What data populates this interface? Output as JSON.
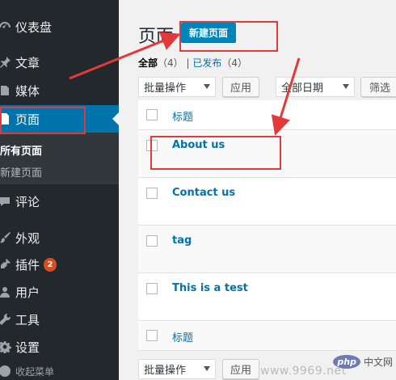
{
  "sidebar": {
    "items": [
      {
        "label": "仪表盘",
        "icon": "dashboard-icon"
      },
      {
        "label": "文章",
        "icon": "pin-icon"
      },
      {
        "label": "媒体",
        "icon": "media-icon"
      },
      {
        "label": "页面",
        "icon": "page-icon"
      },
      {
        "label": "评论",
        "icon": "comment-icon"
      },
      {
        "label": "外观",
        "icon": "brush-icon"
      },
      {
        "label": "插件",
        "icon": "plugin-icon",
        "badge": "2"
      },
      {
        "label": "用户",
        "icon": "user-icon"
      },
      {
        "label": "工具",
        "icon": "wrench-icon"
      },
      {
        "label": "设置",
        "icon": "settings-icon"
      }
    ],
    "submenu": [
      "所有页面",
      "新建页面"
    ],
    "collapse_label": "收起菜单"
  },
  "main": {
    "title": "页面",
    "add_new": "新建页面",
    "filters": {
      "all_label": "全部",
      "all_count": "（4）",
      "separator": "|",
      "published_label": "已发布",
      "published_count": "（4）"
    },
    "bulk_action": "批量操作",
    "apply": "应用",
    "date_filter": "全部日期",
    "filter": "筛选",
    "column_title": "标题",
    "rows": [
      "About us",
      "Contact us",
      "tag",
      "This is a test"
    ]
  },
  "watermark": {
    "url": "www.9969.net",
    "badge": "php",
    "text": "中文网"
  },
  "annotation_color": "#e23a3a"
}
